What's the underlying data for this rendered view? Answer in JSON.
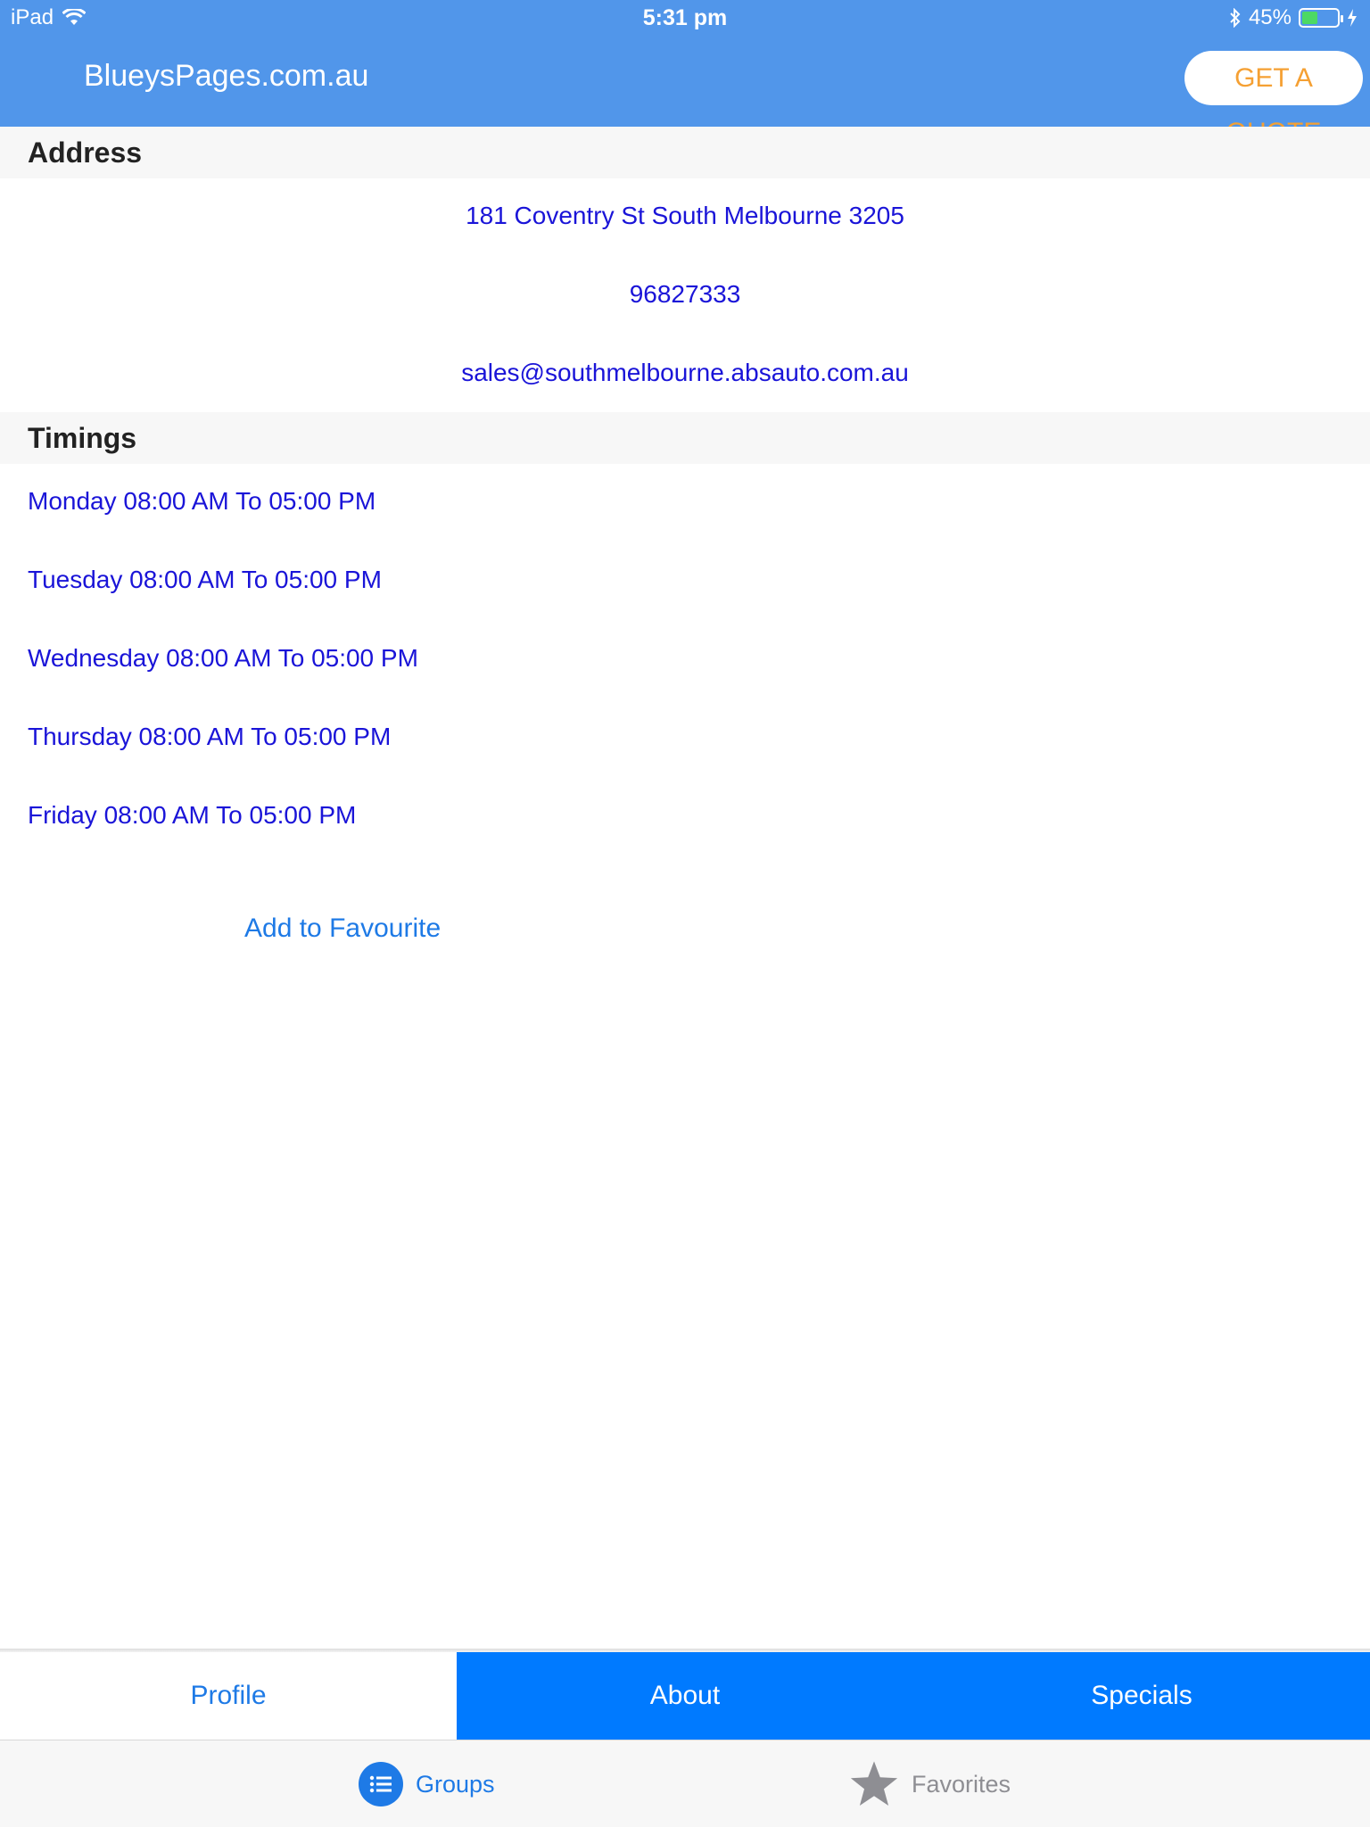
{
  "status": {
    "carrier": "iPad",
    "time": "5:31 pm",
    "battery": "45%",
    "battery_level": 0.45
  },
  "nav": {
    "title": "BlueysPages.com.au",
    "quote_button": "GET A QUOTE"
  },
  "address_section": {
    "header": "Address",
    "street": "181 Coventry St South Melbourne 3205",
    "phone": "96827333",
    "email": "sales@southmelbourne.absauto.com.au"
  },
  "timings_section": {
    "header": "Timings",
    "items": [
      "Monday 08:00 AM To 05:00 PM",
      "Tuesday 08:00 AM To 05:00 PM",
      "Wednesday 08:00 AM To 05:00 PM",
      "Thursday 08:00 AM To 05:00 PM",
      "Friday 08:00 AM To 05:00 PM"
    ]
  },
  "favourite_link": "Add to Favourite",
  "segments": [
    "Profile",
    "About",
    "Specials"
  ],
  "tabbar": {
    "groups": "Groups",
    "favorites": "Favorites"
  },
  "colors": {
    "nav_bg": "#5196ea",
    "quote_text": "#f5a033",
    "link_blue": "#1a14d8",
    "ios_blue": "#007aff"
  }
}
